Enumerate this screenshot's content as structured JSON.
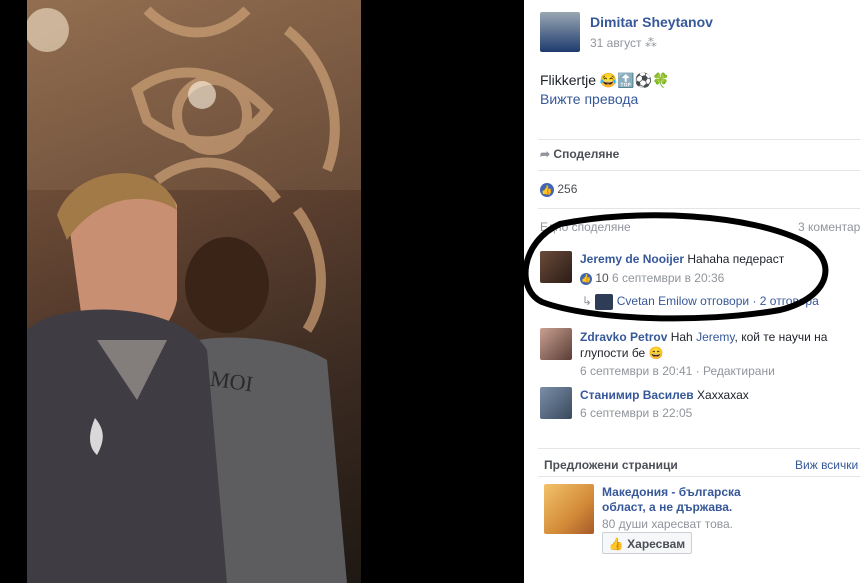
{
  "post": {
    "author": "Dimitar Sheytanov",
    "date": "31 август",
    "privacy_icon": "friends-icon",
    "text": "Flikkertje",
    "emojis": [
      "😂",
      "🔝",
      "⚽",
      "🍀"
    ],
    "translate_link": "Вижте превода",
    "share_label": "Споделяне",
    "likes_count": "256"
  },
  "comments_header": {
    "shares_label": "Едно споделяне",
    "comments_label": "3 коментар"
  },
  "comments": [
    {
      "author": "Jeremy de Nooijer",
      "text": "Hahaha педераст",
      "likes": "10",
      "time": "6 септември в 20:36",
      "reply_author": "Cvetan Emilow",
      "reply_action": "отговори",
      "reply_count": "· 2 отговора"
    },
    {
      "author": "Zdravko Petrov",
      "text_prefix": "Нah",
      "mention": "Jeremy",
      "text_suffix": ", кой те научи на",
      "text_line2": "глупости бе",
      "emoji": "😄",
      "time": "6 септември в 20:41",
      "edited": "· Редактирани"
    },
    {
      "author": "Станимир Василев",
      "text": "Хаххахах",
      "time": "6 септември в 22:05"
    }
  ],
  "suggested": {
    "title": "Предложени страници",
    "see_all": "Виж всички",
    "page_name_line1": "Македония - българска",
    "page_name_line2": "област, а не държава.",
    "likes_text": "80 души харесват това.",
    "like_button": "Харесвам"
  },
  "colors": {
    "link": "#365899",
    "meta": "#90949c",
    "accent": "#4267b2"
  }
}
